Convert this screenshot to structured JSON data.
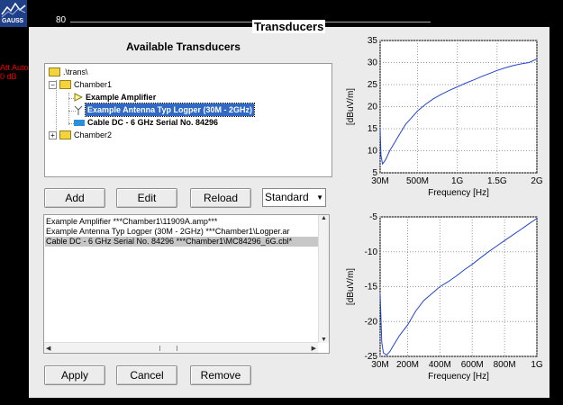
{
  "background": {
    "logo_text": "GAUSS",
    "scale_label": "80",
    "status_lines": [
      "Att Auto",
      "0 dB"
    ]
  },
  "dialog": {
    "title": "Transducers",
    "section_title": "Available Transducers"
  },
  "tree": {
    "nodes": [
      {
        "label": ".\\trans\\",
        "icon": "folder-icon",
        "expander": ""
      },
      {
        "label": "Chamber1",
        "icon": "folder-icon",
        "expander": "−"
      },
      {
        "label": "Example Amplifier",
        "icon": "amplifier-icon",
        "expander": ""
      },
      {
        "label": "Example Antenna Typ Logper (30M - 2GHz)",
        "icon": "antenna-icon",
        "expander": ""
      },
      {
        "label": "Cable DC - 6 GHz Serial No. 84296",
        "icon": "cable-icon",
        "expander": ""
      },
      {
        "label": "Chamber2",
        "icon": "folder-icon",
        "expander": "+"
      }
    ]
  },
  "buttons": {
    "add": "Add",
    "edit": "Edit",
    "reload": "Reload",
    "apply": "Apply",
    "cancel": "Cancel",
    "remove": "Remove"
  },
  "mode_select": {
    "value": "Standard"
  },
  "list": {
    "items": [
      "Example Amplifier ***Chamber1\\11909A.amp***",
      "Example Antenna Typ Logper (30M - 2GHz) ***Chamber1\\Logper.ar",
      "Cable DC - 6 GHz Serial No. 84296 ***Chamber1\\MC84296_6G.cbl*"
    ],
    "selected_index": 2
  },
  "chart_data": [
    {
      "type": "line",
      "xlabel": "Frequency [Hz]",
      "ylabel": "[dBuV/m]",
      "xlim": [
        30000000,
        2000000000
      ],
      "ylim": [
        5,
        35
      ],
      "x_ticks": [
        30000000,
        500000000,
        1000000000,
        1500000000,
        2000000000
      ],
      "x_tick_labels": [
        "30M",
        "500M",
        "1G",
        "1.5G",
        "2G"
      ],
      "y_ticks": [
        5,
        10,
        15,
        20,
        25,
        30,
        35
      ],
      "y_tick_labels": [
        "5",
        "10",
        "15",
        "20",
        "25",
        "30",
        "35"
      ],
      "grid": true,
      "color": "#2244cc",
      "x": [
        30000000,
        40000000,
        60000000,
        80000000,
        100000000,
        150000000,
        200000000,
        250000000,
        300000000,
        350000000,
        400000000,
        450000000,
        500000000,
        600000000,
        700000000,
        800000000,
        900000000,
        1000000000,
        1100000000,
        1200000000,
        1300000000,
        1400000000,
        1500000000,
        1600000000,
        1700000000,
        1800000000,
        1900000000,
        2000000000
      ],
      "y": [
        15.0,
        9.0,
        7.0,
        7.5,
        8.0,
        10.0,
        11.5,
        13.0,
        14.5,
        16.0,
        17.0,
        18.0,
        19.0,
        20.5,
        21.8,
        22.8,
        23.7,
        24.5,
        25.3,
        26.0,
        26.8,
        27.5,
        28.2,
        28.8,
        29.3,
        29.7,
        30.0,
        30.8
      ]
    },
    {
      "type": "line",
      "xlabel": "Frequency [Hz]",
      "ylabel": "[dBuV/m]",
      "xlim": [
        30000000,
        1000000000
      ],
      "ylim": [
        -25,
        -5
      ],
      "x_ticks": [
        30000000,
        200000000,
        400000000,
        600000000,
        800000000,
        1000000000
      ],
      "x_tick_labels": [
        "30M",
        "200M",
        "400M",
        "600M",
        "800M",
        "1G"
      ],
      "y_ticks": [
        -25,
        -20,
        -15,
        -10,
        -5
      ],
      "y_tick_labels": [
        "-25",
        "-20",
        "-15",
        "-10",
        "-5"
      ],
      "grid": true,
      "color": "#2244cc",
      "x": [
        30000000,
        40000000,
        50000000,
        70000000,
        90000000,
        110000000,
        150000000,
        200000000,
        250000000,
        300000000,
        350000000,
        400000000,
        450000000,
        500000000,
        550000000,
        600000000,
        650000000,
        700000000,
        750000000,
        800000000,
        850000000,
        900000000,
        950000000,
        1000000000
      ],
      "y": [
        -16.0,
        -23.0,
        -24.5,
        -24.8,
        -24.3,
        -23.5,
        -22.0,
        -20.5,
        -18.5,
        -17.0,
        -16.0,
        -15.0,
        -14.3,
        -13.5,
        -12.6,
        -11.8,
        -10.9,
        -10.0,
        -9.2,
        -8.4,
        -7.6,
        -6.8,
        -6.0,
        -5.2
      ]
    }
  ]
}
